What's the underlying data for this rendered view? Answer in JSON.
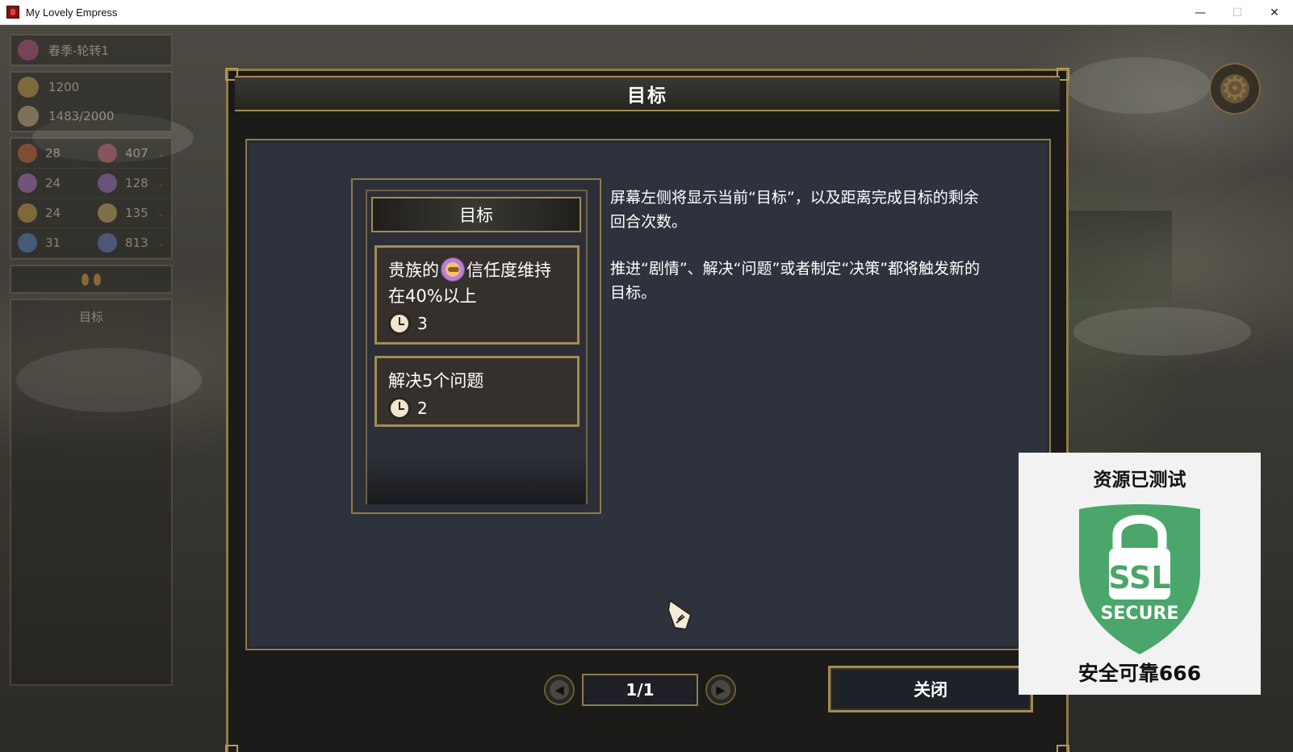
{
  "window": {
    "title": "My Lovely Empress",
    "minimize": "—",
    "maximize": "☐",
    "close": "✕"
  },
  "hud": {
    "season": "春季-轮转1",
    "gold": "1200",
    "capacity": "1483/2000",
    "stats": [
      {
        "left": "28",
        "right": "407"
      },
      {
        "left": "24",
        "right": "128"
      },
      {
        "left": "24",
        "right": "135"
      },
      {
        "left": "31",
        "right": "813"
      }
    ],
    "goal_button": "目标"
  },
  "modal": {
    "title": "目标",
    "goals_panel_title": "目标",
    "goals": [
      {
        "text_before": "贵族的",
        "text_after": "信任度维持在40%以上",
        "turns": "3"
      },
      {
        "text": "解决5个问题",
        "turns": "2"
      }
    ],
    "description": [
      "屏幕左侧将显示当前“目标”，以及距离完成目标的剩余回合次数。",
      "推进“剧情”、解决“问题”或者制定“决策”都将触发新的目标。"
    ],
    "pager": {
      "prev": "◀",
      "label": "1/1",
      "next": "▶"
    },
    "close_label": "关闭"
  },
  "watermark": {
    "top": "资源已测试",
    "badge_line1": "SSL",
    "badge_line2": "SECURE",
    "bottom": "安全可靠666"
  },
  "colors": {
    "gold_border": "#a38b55",
    "content_bg": "#2e323c",
    "card_bg": "#35302c",
    "shield_green": "#4aa66a"
  },
  "icons": [
    "app-icon",
    "gear-icon",
    "trust-icon",
    "clock-icon",
    "hand-cursor-icon",
    "lock-shield-icon"
  ]
}
